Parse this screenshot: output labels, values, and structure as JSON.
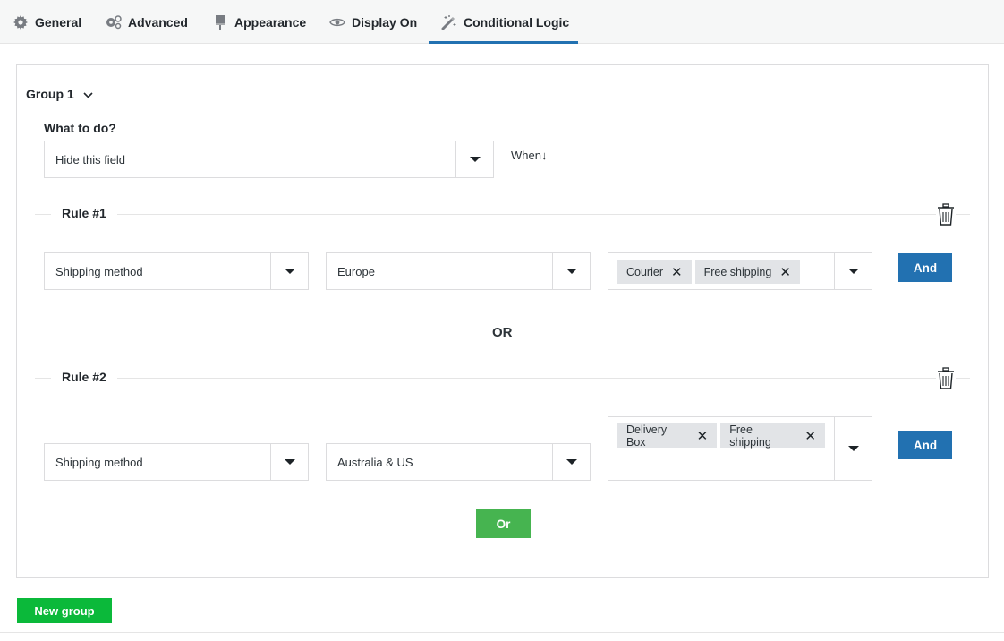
{
  "tabs": [
    {
      "label": "General",
      "icon": "gear-icon",
      "active": false
    },
    {
      "label": "Advanced",
      "icon": "gears-icon",
      "active": false
    },
    {
      "label": "Appearance",
      "icon": "paint-brush-icon",
      "active": false
    },
    {
      "label": "Display On",
      "icon": "eye-icon",
      "active": false
    },
    {
      "label": "Conditional Logic",
      "icon": "magic-wand-icon",
      "active": true
    }
  ],
  "group": {
    "title": "Group 1",
    "what_label": "What to do?",
    "action_value": "Hide this field",
    "when_label": "When↓",
    "rules": [
      {
        "title": "Rule #1",
        "field": "Shipping method",
        "zone": "Europe",
        "values": [
          "Courier",
          "Free shipping"
        ],
        "and_label": "And"
      },
      {
        "title": "Rule #2",
        "field": "Shipping method",
        "zone": "Australia & US",
        "values": [
          "Delivery Box",
          "Free shipping"
        ],
        "and_label": "And"
      }
    ],
    "or_separator": "OR",
    "or_button": "Or"
  },
  "new_group_button": "New group",
  "colors": {
    "accent": "#2271b1",
    "green": "#46b450",
    "new_group_green": "#0bb93a"
  }
}
